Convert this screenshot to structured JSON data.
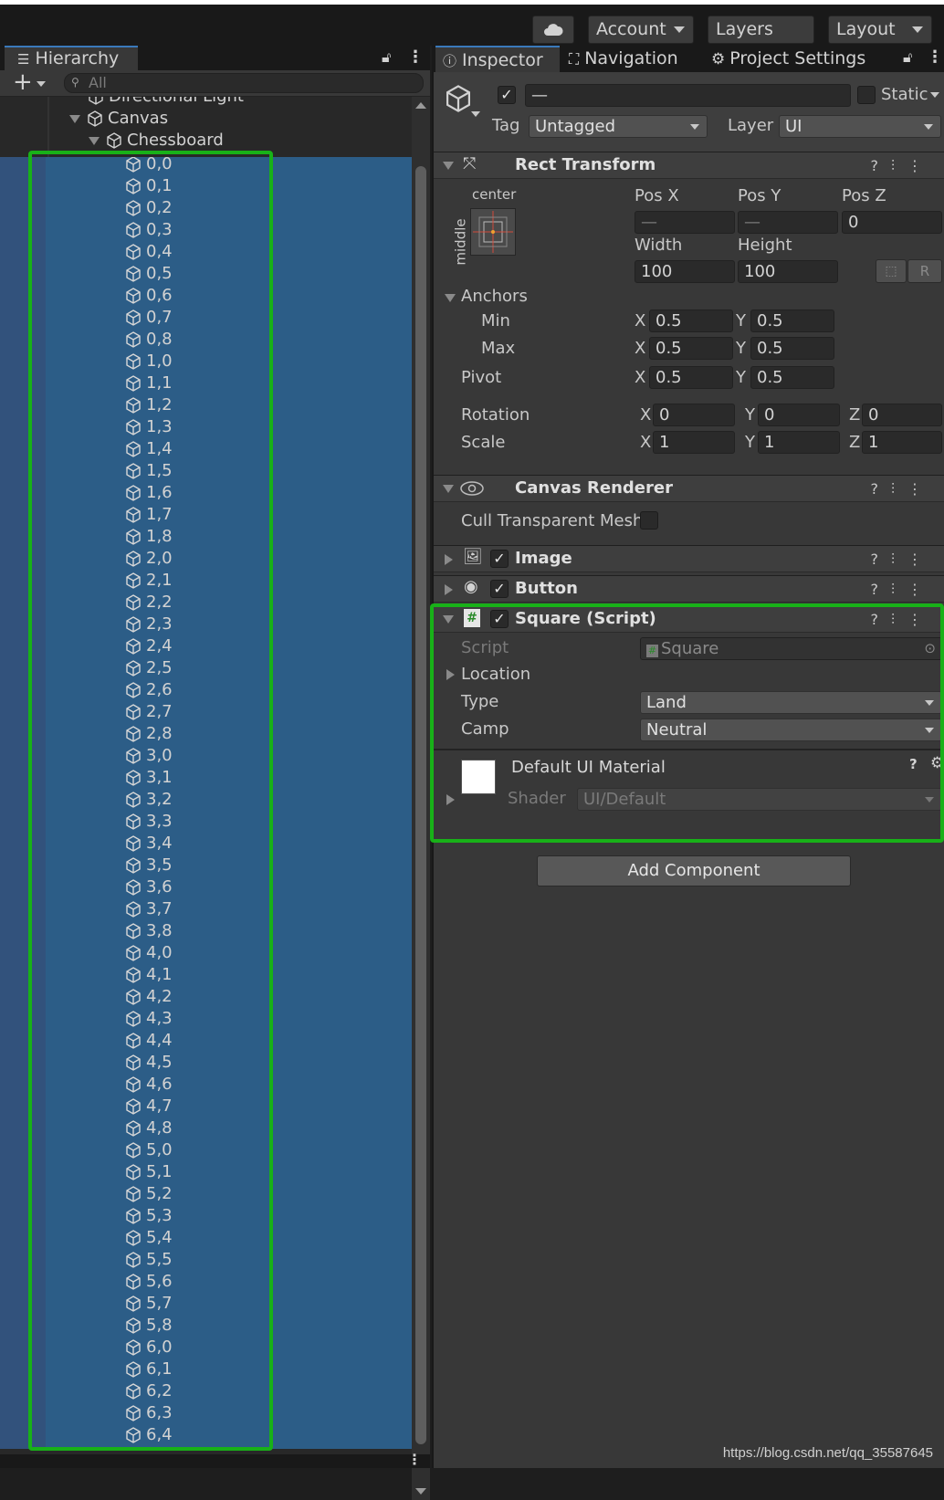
{
  "toolbar": {
    "cloud_icon": "cloud-icon",
    "account_label": "Account",
    "layers_label": "Layers",
    "layout_label": "Layout"
  },
  "hierarchy": {
    "tab_label": "Hierarchy",
    "search_placeholder": "All",
    "tree": {
      "directional_light": "Directional Light",
      "canvas": "Canvas",
      "chessboard": "Chessboard"
    },
    "squares": [
      "0,0",
      "0,1",
      "0,2",
      "0,3",
      "0,4",
      "0,5",
      "0,6",
      "0,7",
      "0,8",
      "1,0",
      "1,1",
      "1,2",
      "1,3",
      "1,4",
      "1,5",
      "1,6",
      "1,7",
      "1,8",
      "2,0",
      "2,1",
      "2,2",
      "2,3",
      "2,4",
      "2,5",
      "2,6",
      "2,7",
      "2,8",
      "3,0",
      "3,1",
      "3,2",
      "3,3",
      "3,4",
      "3,5",
      "3,6",
      "3,7",
      "3,8",
      "4,0",
      "4,1",
      "4,2",
      "4,3",
      "4,4",
      "4,5",
      "4,6",
      "4,7",
      "4,8",
      "5,0",
      "5,1",
      "5,2",
      "5,3",
      "5,4",
      "5,5",
      "5,6",
      "5,7",
      "5,8",
      "6,0",
      "6,1",
      "6,2",
      "6,3",
      "6,4"
    ]
  },
  "inspector": {
    "tabs": {
      "inspector": "Inspector",
      "navigation": "Navigation",
      "project_settings": "Project Settings"
    },
    "object": {
      "name_value": "—",
      "static_label": "Static",
      "tag_label": "Tag",
      "tag_value": "Untagged",
      "layer_label": "Layer",
      "layer_value": "UI"
    },
    "rect_transform": {
      "title": "Rect Transform",
      "anchor_h": "center",
      "anchor_v": "middle",
      "pos_x_label": "Pos X",
      "pos_y_label": "Pos Y",
      "pos_z_label": "Pos Z",
      "pos_x": "—",
      "pos_y": "—",
      "pos_z": "0",
      "width_label": "Width",
      "height_label": "Height",
      "width": "100",
      "height": "100",
      "r_button": "R",
      "anchors_label": "Anchors",
      "min_label": "Min",
      "max_label": "Max",
      "min_x": "0.5",
      "min_y": "0.5",
      "max_x": "0.5",
      "max_y": "0.5",
      "pivot_label": "Pivot",
      "pivot_x": "0.5",
      "pivot_y": "0.5",
      "rotation_label": "Rotation",
      "rot_x": "0",
      "rot_y": "0",
      "rot_z": "0",
      "scale_label": "Scale",
      "scale_x": "1",
      "scale_y": "1",
      "scale_z": "1",
      "x": "X",
      "y": "Y",
      "z": "Z"
    },
    "canvas_renderer": {
      "title": "Canvas Renderer",
      "cull_label": "Cull Transparent Mesh"
    },
    "image": {
      "title": "Image"
    },
    "button": {
      "title": "Button"
    },
    "square_script": {
      "title": "Square (Script)",
      "script_label": "Script",
      "script_value": "Square",
      "location_label": "Location",
      "type_label": "Type",
      "type_value": "Land",
      "camp_label": "Camp",
      "camp_value": "Neutral"
    },
    "material": {
      "name": "Default UI Material",
      "shader_label": "Shader",
      "shader_value": "UI/Default"
    },
    "add_component": "Add Component"
  },
  "watermark": "https://blog.csdn.net/qq_35587645",
  "colors": {
    "selection": "#2c5d87",
    "highlight_box": "#18b118",
    "accent": "#3a79bb"
  }
}
